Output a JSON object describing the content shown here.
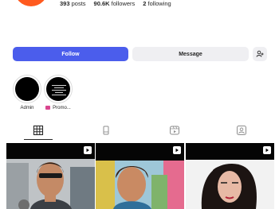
{
  "profile": {
    "posts_count": "393",
    "posts_label": "posts",
    "followers_count": "90.6K",
    "followers_label": "followers",
    "following_count": "2",
    "following_label": "following"
  },
  "actions": {
    "follow_label": "Follow",
    "message_label": "Message"
  },
  "highlights": [
    {
      "label": "Admin"
    },
    {
      "label": "Promo..."
    }
  ],
  "tabs": [
    {
      "icon": "grid-icon",
      "active": true
    },
    {
      "icon": "reels-icon",
      "active": false
    },
    {
      "icon": "video-icon",
      "active": false
    },
    {
      "icon": "tagged-icon",
      "active": false
    }
  ],
  "posts": [
    {
      "type": "reel"
    },
    {
      "type": "reel"
    },
    {
      "type": "reel"
    }
  ],
  "colors": {
    "accent": "#4b5dec",
    "avatar": "#ff5a1f",
    "secondary_button": "#efeff2"
  }
}
